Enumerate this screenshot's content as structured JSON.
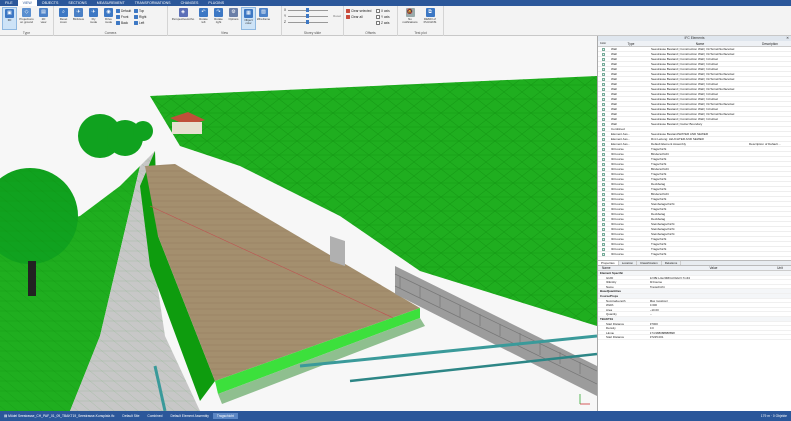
{
  "menu": {
    "tabs": [
      "FILE",
      "VIEW",
      "OBJECTS",
      "SECTIONS",
      "MEASUREMENT",
      "TRANSFORMATIONS",
      "CHANGES",
      "PLUGINS"
    ],
    "active": 1
  },
  "ribbon": {
    "groups": [
      {
        "label": "Type",
        "buttons": [
          "3D",
          "Projections\non ground",
          "2D\nview"
        ]
      },
      {
        "label": "Camera",
        "buttons": [
          "Reset\nzoom",
          "Birdview",
          "Fly\nmode",
          "Drive\nmode"
        ],
        "small": [
          "Default",
          "Front",
          "Back",
          "Top",
          "Right",
          "Left"
        ]
      },
      {
        "label": "View",
        "buttons": [
          "Perspective/ortho",
          "Rotate\nleft",
          "Rotate\nright",
          "Options",
          "Object\ncolor",
          "Wireframe"
        ]
      },
      {
        "label": "Storey slide",
        "sliders": [
          "X",
          "Y",
          "Z"
        ],
        "button": "Reset"
      },
      {
        "label": "Offsets",
        "small": [
          "Clear selected",
          "Clear all",
          "X axis",
          "Y axis",
          "Z axis"
        ]
      },
      {
        "label": "Test plot",
        "buttons": [
          "No\nnotifications",
          "DEMO of\nPLUGINS"
        ]
      }
    ]
  },
  "colors": {
    "brand": "#2b579a",
    "terrain": "#1fae1f",
    "terrain_dark": "#0c8a0c",
    "road": "#a48f6e",
    "kerb": "#3ce03c",
    "trees": "#0f9f1f"
  },
  "panel": {
    "title": "IFC Elements",
    "close": "✕",
    "columns": [
      "Type",
      "Name",
      "Description"
    ],
    "header_icon": "Color",
    "rows": [
      {
        "type": "Wall",
        "name": "Seestrasse Bestand | Construction Wall | OnTerrainSurfaceGel",
        "desc": ""
      },
      {
        "type": "Wall",
        "name": "Seestrasse Bestand | Construction Wall | OnTerrainSurfaceGel",
        "desc": ""
      },
      {
        "type": "Wall",
        "name": "Seestrasse Bestand | Construction Wall | InCutGel",
        "desc": ""
      },
      {
        "type": "Wall",
        "name": "Seestrasse Bestand | Construction Wall | InCutGel",
        "desc": ""
      },
      {
        "type": "Wall",
        "name": "Seestrasse Bestand | Construction Wall | InCutGel",
        "desc": ""
      },
      {
        "type": "Wall",
        "name": "Seestrasse Bestand | Construction Wall | OnTerrainSurfaceGel",
        "desc": ""
      },
      {
        "type": "Wall",
        "name": "Seestrasse Bestand | Construction Wall | OnTerrainSurfaceGel",
        "desc": ""
      },
      {
        "type": "Wall",
        "name": "Seestrasse Bestand | Construction Wall | InCutGel",
        "desc": ""
      },
      {
        "type": "Wall",
        "name": "Seestrasse Bestand | Construction Wall | OnTerrainSurfaceGel",
        "desc": ""
      },
      {
        "type": "Wall",
        "name": "Seestrasse Bestand | Construction Wall | InCutGel",
        "desc": ""
      },
      {
        "type": "Wall",
        "name": "Seestrasse Bestand | Construction Wall | InCutGel",
        "desc": ""
      },
      {
        "type": "Wall",
        "name": "Seestrasse Bestand | Construction Wall | OnTerrainSurfaceGel",
        "desc": ""
      },
      {
        "type": "Wall",
        "name": "Seestrasse Bestand | Construction Wall | InCutGel",
        "desc": ""
      },
      {
        "type": "Wall",
        "name": "Seestrasse Bestand | Construction Wall | OnTerrainSurfaceGel",
        "desc": ""
      },
      {
        "type": "Wall",
        "name": "Seestrasse Bestand | Construction Wall | InCutGel",
        "desc": ""
      },
      {
        "type": "Wall",
        "name": "Seestrasse Bestand | Gutter Boundary",
        "desc": ""
      },
      {
        "type": "Combined",
        "name": "",
        "desc": ""
      },
      {
        "type": "Element Ass...",
        "name": "Seestrasse Bestand/WATER AND SEWER",
        "desc": ""
      },
      {
        "type": "Element Ass...",
        "name": "Rmt Leitung: LEUCHTER AND SEWER",
        "desc": ""
      },
      {
        "type": "Element Ass...",
        "name": "Default Element Assembly",
        "desc": "Description of Default ..."
      },
      {
        "type": "IfcCourse",
        "name": "Tragschicht",
        "desc": ""
      },
      {
        "type": "IfcCourse",
        "name": "Binderschicht",
        "desc": ""
      },
      {
        "type": "IfcCourse",
        "name": "Tragschicht",
        "desc": ""
      },
      {
        "type": "IfcCourse",
        "name": "Tragschicht",
        "desc": ""
      },
      {
        "type": "IfcCourse",
        "name": "Binderschicht",
        "desc": ""
      },
      {
        "type": "IfcCourse",
        "name": "Tragschicht",
        "desc": ""
      },
      {
        "type": "IfcCourse",
        "name": "Tragschicht",
        "desc": ""
      },
      {
        "type": "IfcCourse",
        "name": "Deckbelag",
        "desc": ""
      },
      {
        "type": "IfcCourse",
        "name": "Tragschicht",
        "desc": ""
      },
      {
        "type": "IfcCourse",
        "name": "Binderschicht",
        "desc": ""
      },
      {
        "type": "IfcCourse",
        "name": "Tragschicht",
        "desc": ""
      },
      {
        "type": "IfcCourse",
        "name": "Steinbelagschicht",
        "desc": ""
      },
      {
        "type": "IfcCourse",
        "name": "Tragschicht",
        "desc": ""
      },
      {
        "type": "IfcCourse",
        "name": "Deckbelag",
        "desc": ""
      },
      {
        "type": "IfcCourse",
        "name": "Deckbelag",
        "desc": ""
      },
      {
        "type": "IfcCourse",
        "name": "Steinbelagschicht",
        "desc": ""
      },
      {
        "type": "IfcCourse",
        "name": "Steinbelagschicht",
        "desc": ""
      },
      {
        "type": "IfcCourse",
        "name": "Steinbelagschicht",
        "desc": ""
      },
      {
        "type": "IfcCourse",
        "name": "Tragschicht",
        "desc": ""
      },
      {
        "type": "IfcCourse",
        "name": "Tragschicht",
        "desc": ""
      },
      {
        "type": "IfcCourse",
        "name": "Tragschicht",
        "desc": ""
      },
      {
        "type": "IfcCourse",
        "name": "Tragschicht",
        "desc": ""
      }
    ],
    "tabs": [
      "Properties",
      "Location",
      "Classification",
      "Relations"
    ],
    "prop_columns": [
      "Name",
      "Value",
      "Unit"
    ],
    "props": [
      {
        "section": true,
        "name": "Element Specific",
        "value": "",
        "unit": ""
      },
      {
        "name": "GUID",
        "value": "1rOBr-L3ez0RFtpOGbcV.7ryZ4",
        "unit": ""
      },
      {
        "name": "IfcEntity",
        "value": "IfcCourse",
        "unit": ""
      },
      {
        "name": "Name",
        "value": "Tragschicht",
        "unit": ""
      },
      {
        "section": true,
        "name": "BaseQuantities",
        "value": "",
        "unit": ""
      },
      {
        "section": true,
        "name": "CourseProps",
        "value": "",
        "unit": ""
      },
      {
        "name": "NominalLength",
        "value": "Max (position)",
        "unit": ""
      },
      {
        "name": "Width",
        "value": "0.300",
        "unit": ""
      },
      {
        "name": "Area",
        "value": "~10.00",
        "unit": ""
      },
      {
        "name": "Quantity",
        "value": "--",
        "unit": ""
      },
      {
        "section": true,
        "name": "TBAKT19",
        "value": "",
        "unit": ""
      },
      {
        "name": "Start Distance",
        "value": "37000",
        "unit": ""
      },
      {
        "name": "Density",
        "value": "0.0",
        "unit": ""
      },
      {
        "name": "Länge",
        "value": "174.988088888898",
        "unit": ""
      },
      {
        "name": "Start Distance",
        "value": "37225.001",
        "unit": ""
      }
    ]
  },
  "status": {
    "file": "Mödel Seestrasse_CH_PAF_01_09_TBAKT19_Seestrasse-Kunsplatz.ifc",
    "items": [
      "Default Site",
      "Combined",
      "Default Element Assembly",
      "Tragschicht"
    ],
    "right": "179 m  ·  0 Objekte"
  }
}
